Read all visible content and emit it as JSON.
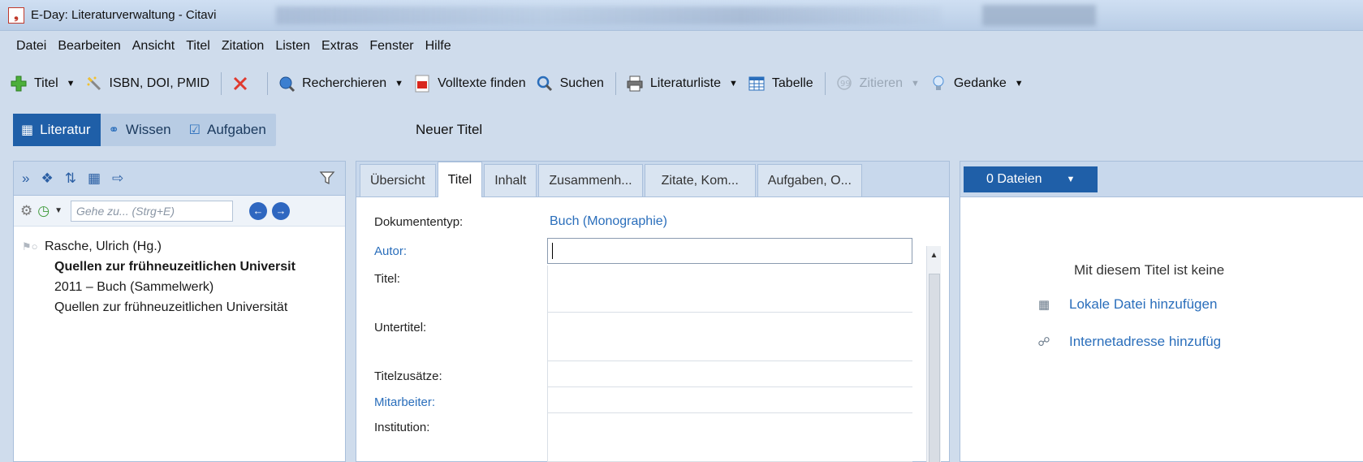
{
  "window": {
    "title": "E-Day: Literaturverwaltung - Citavi"
  },
  "menu": {
    "items": [
      "Datei",
      "Bearbeiten",
      "Ansicht",
      "Titel",
      "Zitation",
      "Listen",
      "Extras",
      "Fenster",
      "Hilfe"
    ]
  },
  "toolbar": {
    "titel": "Titel",
    "isbn": "ISBN, DOI, PMID",
    "recherchieren": "Recherchieren",
    "volltexte": "Volltexte finden",
    "suchen": "Suchen",
    "literaturliste": "Literaturliste",
    "tabelle": "Tabelle",
    "zitieren": "Zitieren",
    "gedanke": "Gedanke"
  },
  "nav": {
    "literatur": "Literatur",
    "wissen": "Wissen",
    "aufgaben": "Aufgaben",
    "neuer_titel": "Neuer Titel"
  },
  "left": {
    "goto_placeholder": "Gehe zu... (Strg+E)",
    "entry": {
      "author": "Rasche, Ulrich (Hg.)",
      "title": "Quellen zur frühneuzeitlichen Universit",
      "year_type": "2011 – Buch (Sammelwerk)",
      "series": "Quellen zur frühneuzeitlichen Universität"
    }
  },
  "tabs": [
    "Übersicht",
    "Titel",
    "Inhalt",
    "Zusammenh...",
    "Zitate, Kom...",
    "Aufgaben, O..."
  ],
  "form": {
    "dokumententyp_label": "Dokumententyp:",
    "dokumententyp_value": "Buch (Monographie)",
    "autor_label": "Autor:",
    "autor_value": "",
    "titel_label": "Titel:",
    "untertitel_label": "Untertitel:",
    "titelzusaetze_label": "Titelzusätze:",
    "mitarbeiter_label": "Mitarbeiter:",
    "institution_label": "Institution:"
  },
  "right": {
    "dateien": "0 Dateien",
    "no_file_text": "Mit diesem Titel ist keine",
    "lokale_datei": "Lokale Datei hinzufügen",
    "internetadresse": "Internetadresse hinzufüg"
  },
  "colors": {
    "accent": "#1f5fa8",
    "link": "#2a6ebb",
    "panel_header": "#c8d8ec"
  }
}
